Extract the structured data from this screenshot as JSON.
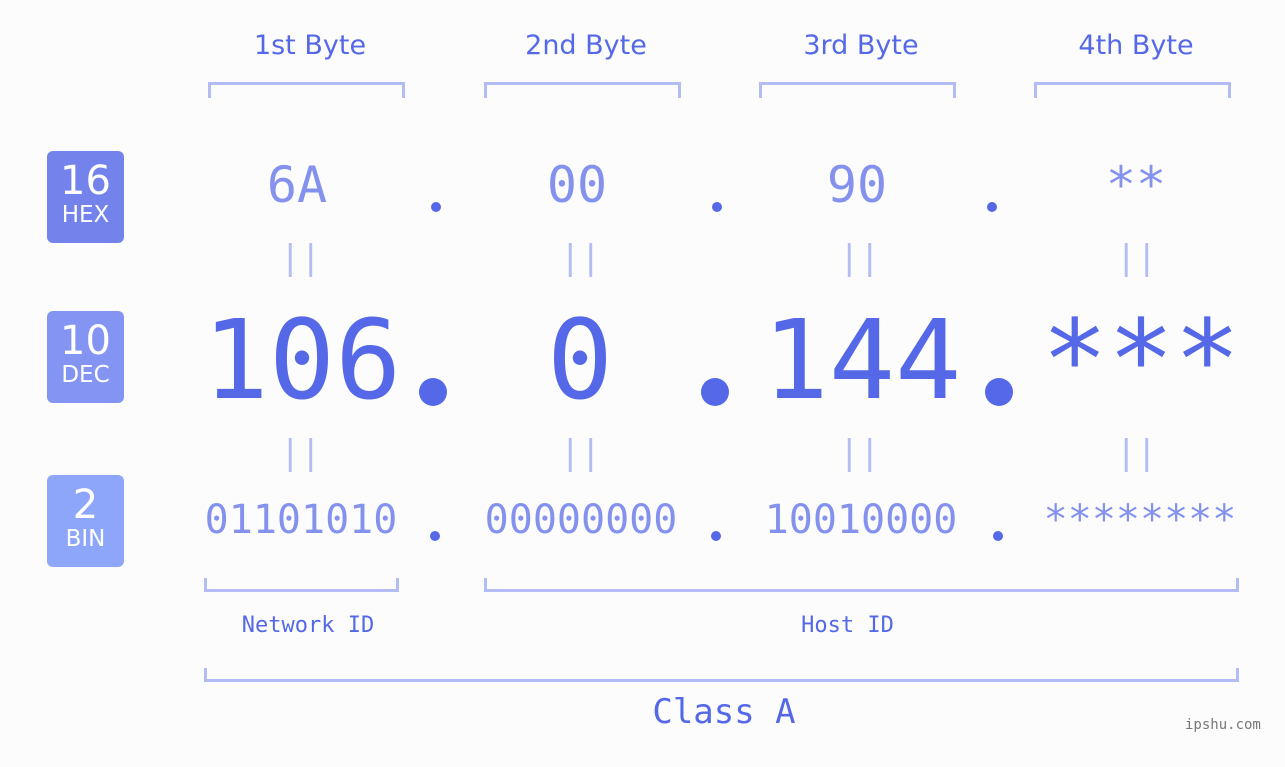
{
  "byte_headers": [
    "1st Byte",
    "2nd Byte",
    "3rd Byte",
    "4th Byte"
  ],
  "badges": [
    {
      "base": "16",
      "name": "HEX",
      "color": "#7483eb"
    },
    {
      "base": "10",
      "name": "DEC",
      "color": "#8494f2"
    },
    {
      "base": "2",
      "name": "BIN",
      "color": "#8da6fa"
    }
  ],
  "hex": [
    "6A",
    "00",
    "90",
    "**"
  ],
  "dec": [
    "106",
    "0",
    "144",
    "***"
  ],
  "bin": [
    "01101010",
    "00000000",
    "10010000",
    "********"
  ],
  "equals_glyph": "||",
  "network_id_label": "Network ID",
  "host_id_label": "Host ID",
  "class_label": "Class A",
  "watermark": "ipshu.com",
  "colors": {
    "accent": "#5468e8",
    "light": "#8492ee",
    "bracket": "#b3bcf5"
  }
}
